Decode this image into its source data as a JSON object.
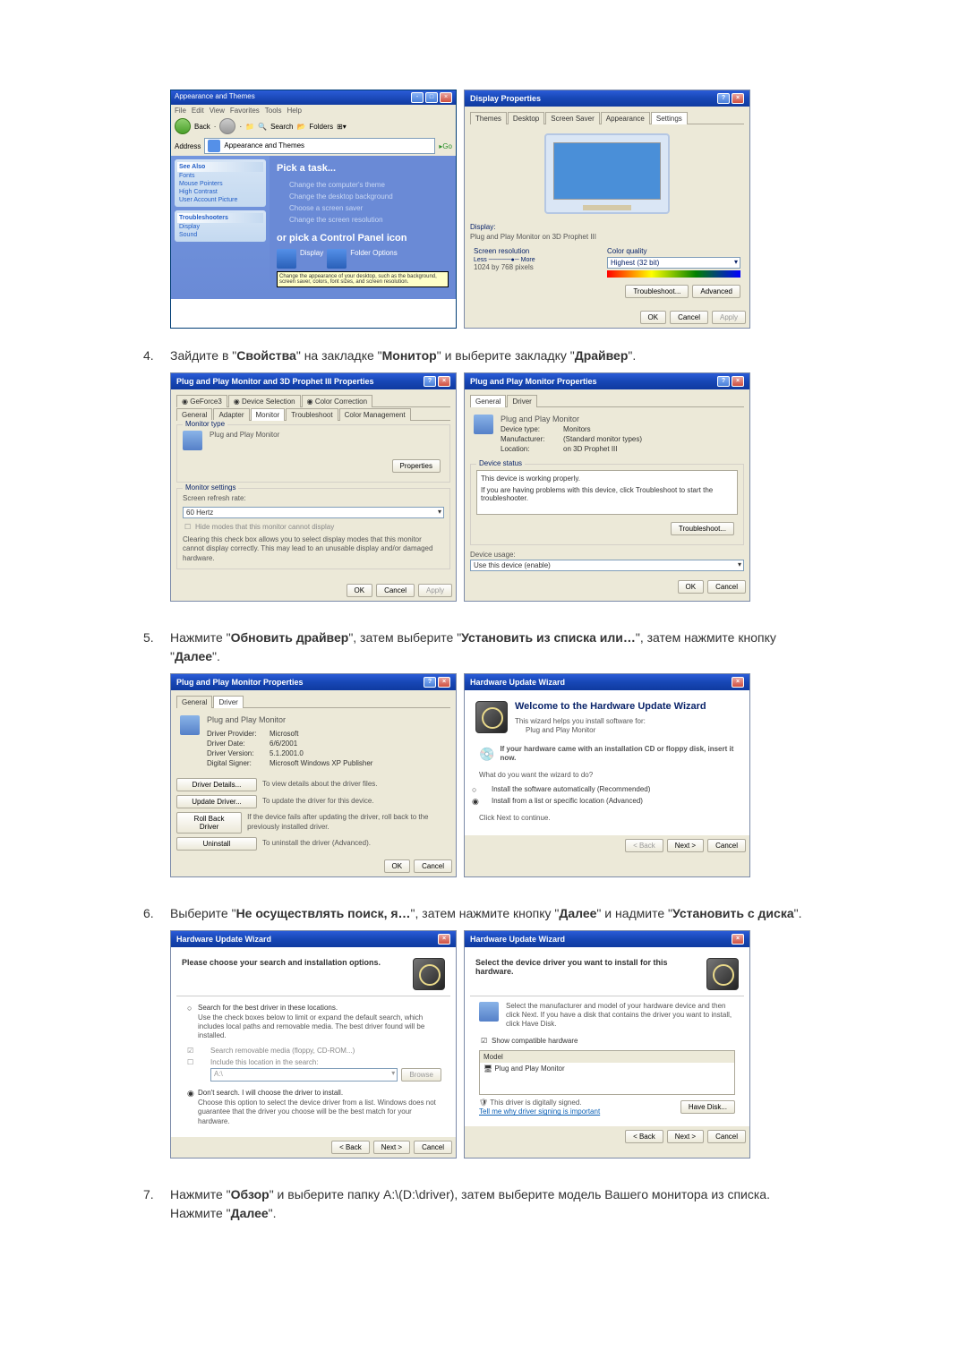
{
  "steps": {
    "s4": {
      "num": "4.",
      "text_parts": [
        "Зайдите в \"",
        "Свойства",
        "\" на закладке \"",
        "Монитор",
        "\" и выберите закладку \"",
        "Драйвер",
        "\"."
      ]
    },
    "s5": {
      "num": "5.",
      "text_parts": [
        "Нажмите \"",
        "Обновить драйвер",
        "\", затем выберите \"",
        "Установить из списка или…",
        "\", затем нажмите кнопку \"",
        "Далее",
        "\"."
      ]
    },
    "s6": {
      "num": "6.",
      "text_parts": [
        "Выберите \"",
        "Не осуществлять поиск, я…",
        "\", затем нажмите кнопку \"",
        "Далее",
        "\" и надмите \"",
        "Установить с диска",
        "\"."
      ]
    },
    "s7": {
      "num": "7.",
      "text_parts_a": [
        "Нажмите \"",
        "Обзор",
        "\" и выберите папку A:\\(D:\\driver), затем выберите модель Вашего монитора из списка. Нажмите \"",
        "Далее",
        "\"."
      ]
    }
  },
  "cp": {
    "titlebar": "Appearance and Themes",
    "menu": {
      "file": "File",
      "edit": "Edit",
      "view": "View",
      "fav": "Favorites",
      "tools": "Tools",
      "help": "Help"
    },
    "back": "Back",
    "search": "Search",
    "folders": "Folders",
    "address_lbl": "Address",
    "address_val": "Appearance and Themes",
    "go": "Go",
    "side_hdr1": "See Also",
    "side_items1": [
      "Fonts",
      "Mouse Pointers",
      "High Contrast",
      "User Account Picture"
    ],
    "side_hdr2": "Troubleshooters",
    "side_items2": [
      "Display",
      "Sound"
    ],
    "heading1": "Pick a task...",
    "tasks": [
      "Change the computer's theme",
      "Change the desktop background",
      "Choose a screen saver",
      "Change the screen resolution"
    ],
    "heading2": "or pick a Control Panel icon",
    "icon1": "Display",
    "icon2": "Folder Options",
    "note": "Change the appearance of your desktop, such as the background, screen saver, colors, font sizes, and screen resolution."
  },
  "disp_props": {
    "title": "Display Properties",
    "tabs": [
      "Themes",
      "Desktop",
      "Screen Saver",
      "Appearance",
      "Settings"
    ],
    "display_lbl": "Display:",
    "display_val": "Plug and Play Monitor on 3D Prophet III",
    "res_lbl": "Screen resolution",
    "res_less": "Less",
    "res_more": "More",
    "res_val": "1024 by 768 pixels",
    "color_lbl": "Color quality",
    "color_val": "Highest (32 bit)",
    "btn_trouble": "Troubleshoot...",
    "btn_adv": "Advanced",
    "btn_ok": "OK",
    "btn_cancel": "Cancel",
    "btn_apply": "Apply"
  },
  "adv_props": {
    "title": "Plug and Play Monitor and 3D Prophet III Properties",
    "tabs_top": [
      "GeForce3",
      "Device Selection",
      "Color Correction"
    ],
    "tabs_bot": [
      "General",
      "Adapter",
      "Monitor",
      "Troubleshoot",
      "Color Management"
    ],
    "mon_type_lbl": "Monitor type",
    "mon_type_val": "Plug and Play Monitor",
    "btn_props": "Properties",
    "mon_settings_lbl": "Monitor settings",
    "refresh_lbl": "Screen refresh rate:",
    "refresh_val": "60 Hertz",
    "hide_modes": "Hide modes that this monitor cannot display",
    "hide_desc": "Clearing this check box allows you to select display modes that this monitor cannot display correctly. This may lead to an unusable display and/or damaged hardware.",
    "btn_ok": "OK",
    "btn_cancel": "Cancel",
    "btn_apply": "Apply"
  },
  "mon_props": {
    "title": "Plug and Play Monitor Properties",
    "tab_gen": "General",
    "tab_drv": "Driver",
    "name": "Plug and Play Monitor",
    "dev_type_lbl": "Device type:",
    "dev_type_val": "Monitors",
    "manu_lbl": "Manufacturer:",
    "manu_val": "(Standard monitor types)",
    "loc_lbl": "Location:",
    "loc_val": "on 3D Prophet III",
    "status_lbl": "Device status",
    "status_txt": "This device is working properly.",
    "status_help": "If you are having problems with this device, click Troubleshoot to start the troubleshooter.",
    "btn_trouble": "Troubleshoot...",
    "usage_lbl": "Device usage:",
    "usage_val": "Use this device (enable)",
    "btn_ok": "OK",
    "btn_cancel": "Cancel"
  },
  "mon_drv": {
    "title": "Plug and Play Monitor Properties",
    "tab_gen": "General",
    "tab_drv": "Driver",
    "name": "Plug and Play Monitor",
    "prov_lbl": "Driver Provider:",
    "prov_val": "Microsoft",
    "date_lbl": "Driver Date:",
    "date_val": "6/6/2001",
    "ver_lbl": "Driver Version:",
    "ver_val": "5.1.2001.0",
    "sig_lbl": "Digital Signer:",
    "sig_val": "Microsoft Windows XP Publisher",
    "btn_details": "Driver Details...",
    "desc_details": "To view details about the driver files.",
    "btn_update": "Update Driver...",
    "desc_update": "To update the driver for this device.",
    "btn_rollback": "Roll Back Driver",
    "desc_rollback": "If the device fails after updating the driver, roll back to the previously installed driver.",
    "btn_uninstall": "Uninstall",
    "desc_uninstall": "To uninstall the driver (Advanced).",
    "btn_ok": "OK",
    "btn_cancel": "Cancel"
  },
  "wiz1": {
    "title": "Hardware Update Wizard",
    "heading": "Welcome to the Hardware Update Wizard",
    "intro": "This wizard helps you install software for:",
    "device": "Plug and Play Monitor",
    "cd_hint": "If your hardware came with an installation CD or floppy disk, insert it now.",
    "question": "What do you want the wizard to do?",
    "opt1": "Install the software automatically (Recommended)",
    "opt2": "Install from a list or specific location (Advanced)",
    "continue": "Click Next to continue.",
    "btn_back": "< Back",
    "btn_next": "Next >",
    "btn_cancel": "Cancel"
  },
  "wiz2": {
    "title": "Hardware Update Wizard",
    "heading": "Please choose your search and installation options.",
    "opt1": "Search for the best driver in these locations.",
    "opt1_desc": "Use the check boxes below to limit or expand the default search, which includes local paths and removable media. The best driver found will be installed.",
    "chk1": "Search removable media (floppy, CD-ROM...)",
    "chk2": "Include this location in the search:",
    "path": "A:\\",
    "btn_browse": "Browse",
    "opt2": "Don't search. I will choose the driver to install.",
    "opt2_desc": "Choose this option to select the device driver from a list. Windows does not guarantee that the driver you choose will be the best match for your hardware.",
    "btn_back": "< Back",
    "btn_next": "Next >",
    "btn_cancel": "Cancel"
  },
  "wiz3": {
    "title": "Hardware Update Wizard",
    "heading": "Select the device driver you want to install for this hardware.",
    "desc": "Select the manufacturer and model of your hardware device and then click Next. If you have a disk that contains the driver you want to install, click Have Disk.",
    "chk_compat": "Show compatible hardware",
    "model_lbl": "Model",
    "model_val": "Plug and Play Monitor",
    "signed": "This driver is digitally signed.",
    "why_link": "Tell me why driver signing is important",
    "btn_disk": "Have Disk...",
    "btn_back": "< Back",
    "btn_next": "Next >",
    "btn_cancel": "Cancel"
  }
}
